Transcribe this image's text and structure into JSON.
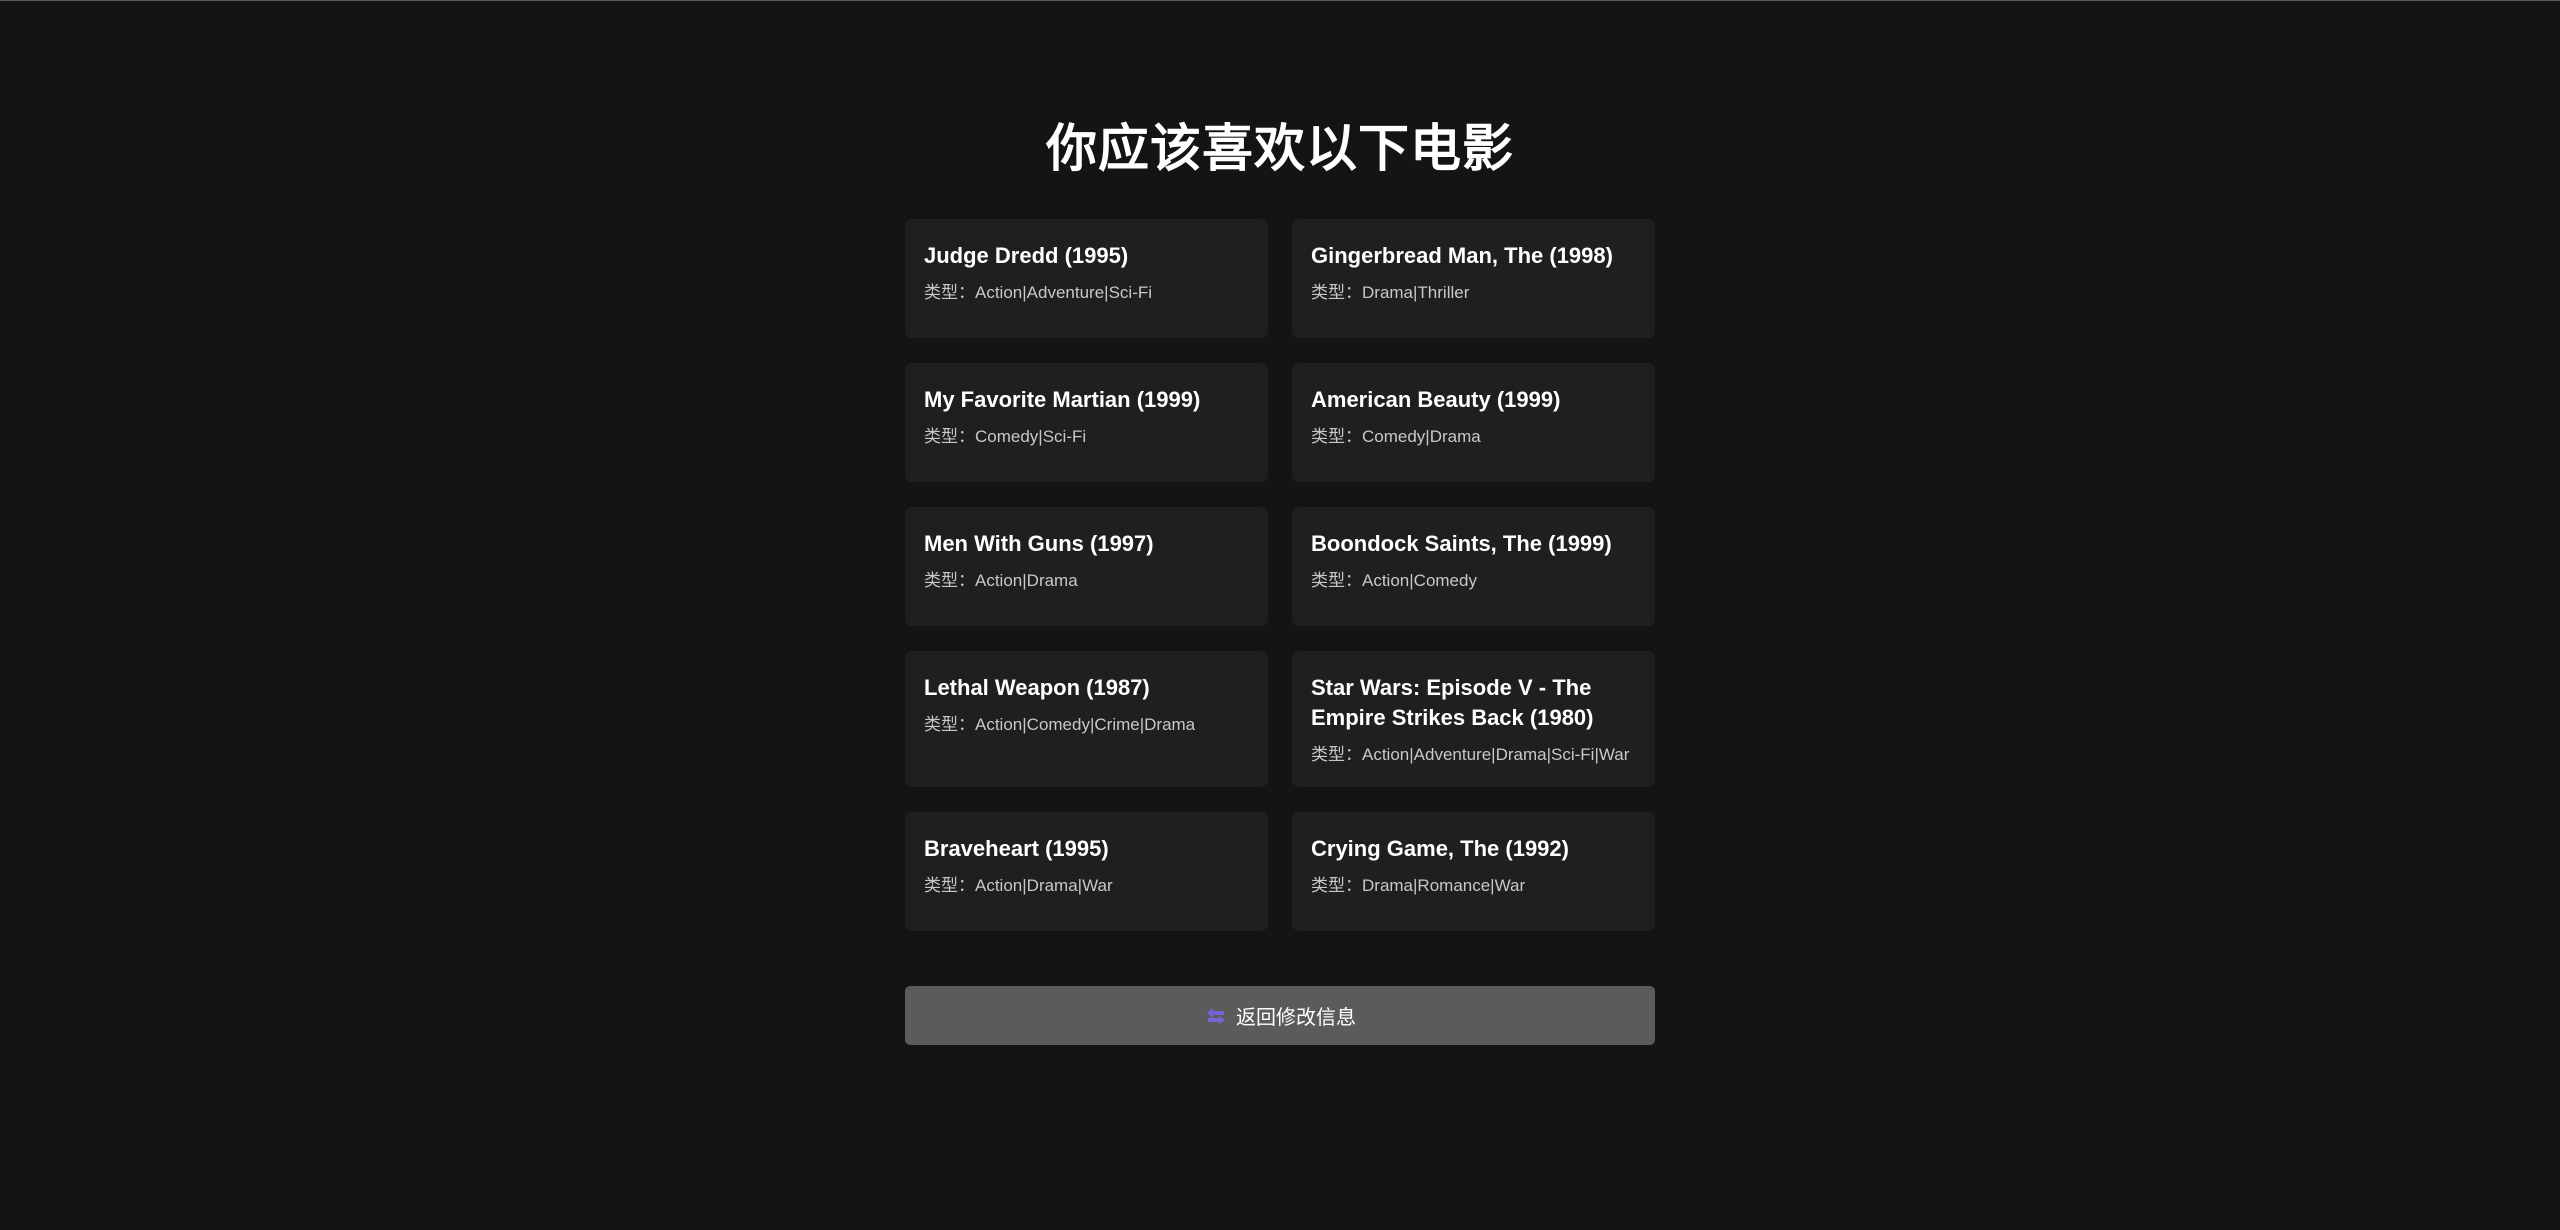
{
  "page": {
    "title": "你应该喜欢以下电影"
  },
  "genre_prefix": "类型：",
  "movies": [
    {
      "title": "Judge Dredd (1995)",
      "genres": "Action|Adventure|Sci-Fi"
    },
    {
      "title": "Gingerbread Man, The (1998)",
      "genres": "Drama|Thriller"
    },
    {
      "title": "My Favorite Martian (1999)",
      "genres": "Comedy|Sci-Fi"
    },
    {
      "title": "American Beauty (1999)",
      "genres": "Comedy|Drama"
    },
    {
      "title": "Men With Guns (1997)",
      "genres": "Action|Drama"
    },
    {
      "title": "Boondock Saints, The (1999)",
      "genres": "Action|Comedy"
    },
    {
      "title": "Lethal Weapon (1987)",
      "genres": "Action|Comedy|Crime|Drama"
    },
    {
      "title": "Star Wars: Episode V - The Empire Strikes Back (1980)",
      "genres": "Action|Adventure|Drama|Sci-Fi|War"
    },
    {
      "title": "Braveheart (1995)",
      "genres": "Action|Drama|War"
    },
    {
      "title": "Crying Game, The (1992)",
      "genres": "Drama|Romance|War"
    }
  ],
  "back_button": {
    "label": "返回修改信息",
    "icon": "back-arrow-icon",
    "icon_color": "#7b61d6"
  },
  "colors": {
    "background": "#141414",
    "card": "#1f1f1f",
    "button": "#5b5b5b"
  }
}
